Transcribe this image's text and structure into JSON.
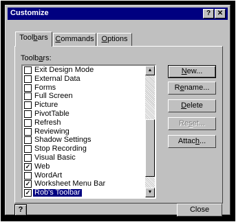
{
  "window": {
    "title": "Customize",
    "help_btn": "?",
    "close_btn": "✕"
  },
  "tabs": [
    {
      "label_pre": "Tool",
      "label_u": "b",
      "label_post": "ars"
    },
    {
      "label_pre": "",
      "label_u": "C",
      "label_post": "ommands"
    },
    {
      "label_pre": "",
      "label_u": "O",
      "label_post": "ptions"
    }
  ],
  "toolbars_label": {
    "pre": "Toolb",
    "u": "a",
    "post": "rs:"
  },
  "items": [
    {
      "label": "Exit Design Mode",
      "checked": false
    },
    {
      "label": "External Data",
      "checked": false
    },
    {
      "label": "Forms",
      "checked": false
    },
    {
      "label": "Full Screen",
      "checked": false
    },
    {
      "label": "Picture",
      "checked": false
    },
    {
      "label": "PivotTable",
      "checked": false
    },
    {
      "label": "Refresh",
      "checked": false
    },
    {
      "label": "Reviewing",
      "checked": false
    },
    {
      "label": "Shadow Settings",
      "checked": false
    },
    {
      "label": "Stop Recording",
      "checked": false
    },
    {
      "label": "Visual Basic",
      "checked": false
    },
    {
      "label": "Web",
      "checked": true
    },
    {
      "label": "WordArt",
      "checked": false
    },
    {
      "label": "Worksheet Menu Bar",
      "checked": true
    },
    {
      "label": "Rob's Toolbar",
      "checked": true,
      "selected": true
    }
  ],
  "buttons": {
    "new": {
      "pre": "",
      "u": "N",
      "post": "ew..."
    },
    "rename": {
      "pre": "R",
      "u": "e",
      "post": "name..."
    },
    "delete": {
      "pre": "",
      "u": "D",
      "post": "elete"
    },
    "reset": {
      "pre": "Re",
      "u": "s",
      "post": "et..."
    },
    "attach": {
      "pre": "Attac",
      "u": "h",
      "post": "..."
    }
  },
  "footer": {
    "help_icon": "?",
    "close": "Close"
  },
  "colors": {
    "titlebar": "#000080",
    "face": "#c0c0c0",
    "selection": "#000080"
  }
}
